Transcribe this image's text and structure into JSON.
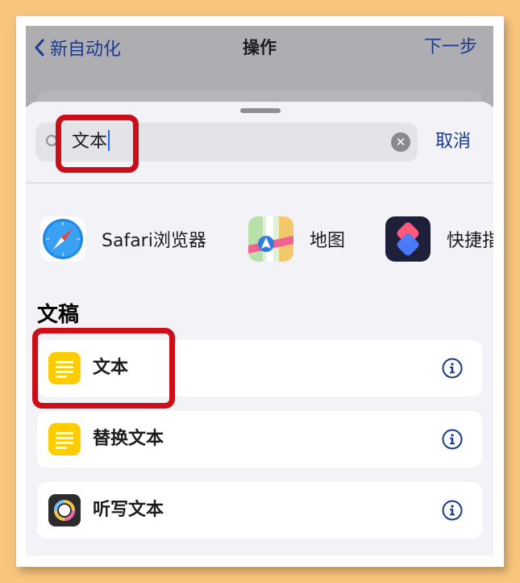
{
  "nav": {
    "back_label": "新自动化",
    "title": "操作",
    "next_label": "下一步"
  },
  "search": {
    "value": "文本",
    "cancel_label": "取消"
  },
  "apps": [
    {
      "label": "Safari浏览器",
      "icon": "safari-icon"
    },
    {
      "label": "地图",
      "icon": "maps-icon"
    },
    {
      "label": "快捷指令",
      "icon": "shortcuts-icon"
    }
  ],
  "section": {
    "title": "文稿"
  },
  "actions": [
    {
      "label": "文本",
      "icon": "document-text-icon"
    },
    {
      "label": "替换文本",
      "icon": "document-text-icon"
    },
    {
      "label": "听写文本",
      "icon": "dictate-icon"
    }
  ],
  "colors": {
    "accent": "#1a3a8f",
    "highlight": "#cc0e18",
    "doc_icon": "#ffcc00",
    "page_background": "#f8c57e"
  }
}
